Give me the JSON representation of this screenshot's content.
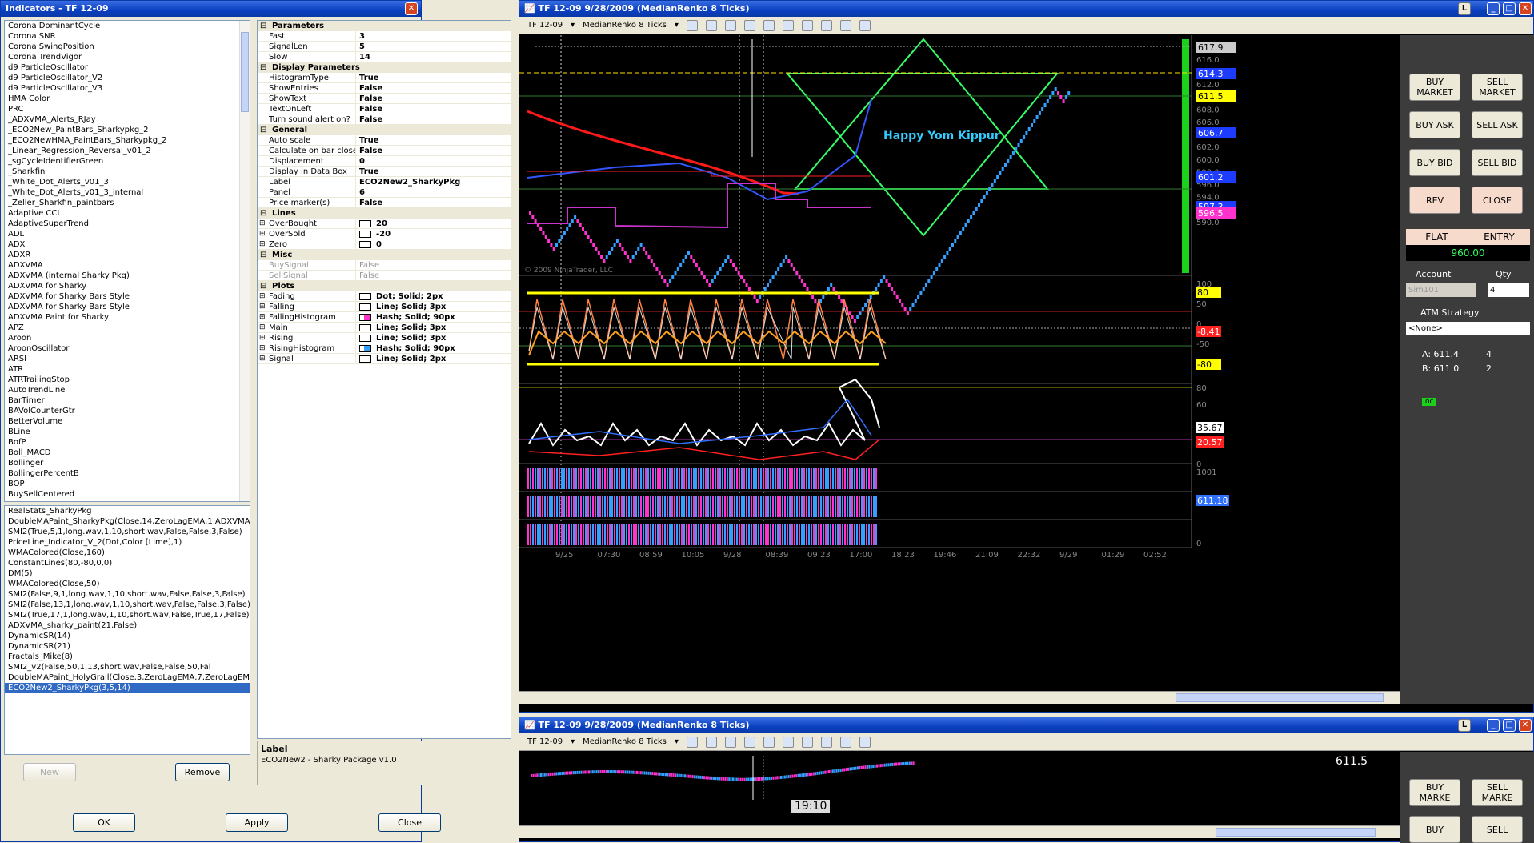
{
  "dialog": {
    "title": "Indicators - TF 12-09",
    "available": [
      "Corona DominantCycle",
      "Corona SNR",
      "Corona SwingPosition",
      "Corona TrendVigor",
      "d9 ParticleOscillator",
      "d9 ParticleOscillator_V2",
      "d9 ParticleOscillator_V3",
      "HMA Color",
      "PRC",
      "_ADXVMA_Alerts_RJay",
      "_ECO2New_PaintBars_Sharkypkg_2",
      "_ECO2NewHMA_PaintBars_Sharkypkg_2",
      "_Linear_Regression_Reversal_v01_2",
      "_sgCycleIdentifierGreen",
      "_Sharkfin",
      "_White_Dot_Alerts_v01_3",
      "_White_Dot_Alerts_v01_3_internal",
      "_Zeller_Sharkfin_paintbars",
      "Adaptive CCI",
      "AdaptiveSuperTrend",
      "ADL",
      "ADX",
      "ADXR",
      "ADXVMA",
      "ADXVMA (internal Sharky Pkg)",
      "ADXVMA for Sharky",
      "ADXVMA for Sharky Bars Style",
      "ADXVMA for Sharky Bars Style",
      "ADXVMA Paint for Sharky",
      "APZ",
      "Aroon",
      "AroonOscillator",
      "ARSI",
      "ATR",
      "ATRTrailingStop",
      "AutoTrendLine",
      "BarTimer",
      "BAVolCounterGtr",
      "BetterVolume",
      "BLine",
      "BofP",
      "Boll_MACD",
      "Bollinger",
      "BollingerPercentB",
      "BOP",
      "BuySellCentered"
    ],
    "applied": [
      "RealStats_SharkyPkg",
      "DoubleMAPaint_SharkyPkg(Close,14,ZeroLagEMA,1,ADXVMA)",
      "SMI2(True,5,1,long.wav,1,10,short.wav,False,False,3,False)",
      "PriceLine_Indicator_V_2(Dot,Color [Lime],1)",
      "WMAColored(Close,160)",
      "ConstantLines(80,-80,0,0)",
      "DM(5)",
      "WMAColored(Close,50)",
      "SMI2(False,9,1,long.wav,1,10,short.wav,False,False,3,False)",
      "SMI2(False,13,1,long.wav,1,10,short.wav,False,False,3,False)",
      "SMI2(True,17,1,long.wav,1,10,short.wav,False,True,17,False)",
      "ADXVMA_sharky_paint(21,False)",
      "DynamicSR(14)",
      "DynamicSR(21)",
      "Fractals_Mike(8)",
      "SMI2_v2(False,50,1,13,short.wav,False,False,50,Fal",
      "DoubleMAPaint_HolyGrail(Close,3,ZeroLagEMA,7,ZeroLagEMA",
      "ECO2New2_SharkyPkg(3,5,14)"
    ],
    "buttons": {
      "new": "New",
      "remove": "Remove",
      "ok": "OK",
      "apply": "Apply",
      "close": "Close"
    },
    "desc": {
      "title": "Label",
      "text": "ECO2New2 - Sharky Package v1.0"
    },
    "props": [
      {
        "cat": "Parameters",
        "rows": [
          [
            "Fast",
            "3"
          ],
          [
            "SignalLen",
            "5"
          ],
          [
            "Slow",
            "14"
          ]
        ]
      },
      {
        "cat": "Display Parameters",
        "rows": [
          [
            "HistogramType",
            "True"
          ],
          [
            "ShowEntries",
            "False"
          ],
          [
            "ShowText",
            "False"
          ],
          [
            "TextOnLeft",
            "False"
          ],
          [
            "Turn sound alert on?",
            "False"
          ]
        ]
      },
      {
        "cat": "General",
        "rows": [
          [
            "Auto scale",
            "True"
          ],
          [
            "Calculate on bar close",
            "False"
          ],
          [
            "Displacement",
            "0"
          ],
          [
            "Display in Data Box",
            "True"
          ],
          [
            "Label",
            "ECO2New2_SharkyPkg"
          ],
          [
            "Panel",
            "6"
          ],
          [
            "Price marker(s)",
            "False"
          ]
        ]
      },
      {
        "cat": "Lines",
        "rows": [
          [
            "OverBought",
            "20",
            1
          ],
          [
            "OverSold",
            "-20",
            1
          ],
          [
            "Zero",
            "0",
            1
          ]
        ]
      },
      {
        "cat": "Misc",
        "rows": [
          [
            "BuySignal",
            "False",
            0,
            1
          ],
          [
            "SellSignal",
            "False",
            0,
            1
          ]
        ]
      },
      {
        "cat": "Plots",
        "rows": [
          [
            "Fading",
            "Dot; Solid; 2px",
            1
          ],
          [
            "Falling",
            "Line; Solid; 3px",
            1
          ],
          [
            "FallingHistogram",
            "Hash; Solid; 90px",
            2
          ],
          [
            "Main",
            "Line; Solid; 3px",
            1
          ],
          [
            "Rising",
            "Line; Solid; 3px",
            1
          ],
          [
            "RisingHistogram",
            "Hash; Solid; 90px",
            3
          ],
          [
            "Signal",
            "Line; Solid; 2px",
            1
          ]
        ]
      }
    ]
  },
  "chart1": {
    "title": "TF 12-09  9/28/2009 (MedianRenko 8 Ticks)",
    "instrument": "TF 12-09",
    "period": "MedianRenko 8 Ticks",
    "annotation": "Happy Yom Kippur",
    "copyright": "© 2009 NinjaTrader, LLC",
    "price_ticks": [
      "616.0",
      "614.0",
      "612.0",
      "610.0",
      "608.0",
      "606.0",
      "604.0",
      "602.0",
      "600.0",
      "598.0",
      "596.0",
      "594.0",
      "592.0",
      "590.0"
    ],
    "price_markers": [
      {
        "v": "617.9",
        "c": "#cccccc"
      },
      {
        "v": "614.3",
        "c": "#1e3cff"
      },
      {
        "v": "611.5",
        "c": "#ffff00"
      },
      {
        "v": "606.7",
        "c": "#1e3cff"
      },
      {
        "v": "601.2",
        "c": "#1e3cff"
      },
      {
        "v": "597.3",
        "c": "#1e3cff"
      },
      {
        "v": "596.5",
        "c": "#ff33cc"
      }
    ],
    "osc_ticks": [
      "100",
      "50",
      "0",
      "-50",
      "-100"
    ],
    "osc_markers": [
      {
        "v": "80",
        "c": "#ffff00"
      },
      {
        "v": "-8.41",
        "c": "#ff2020"
      },
      {
        "v": "-80",
        "c": "#ffff00"
      }
    ],
    "dm_ticks": [
      "80",
      "60",
      "20",
      "0"
    ],
    "dm_markers": [
      {
        "v": "35.67",
        "c": "#ffffff"
      },
      {
        "v": "20.57",
        "c": "#ff2020"
      }
    ],
    "hist_ticks": [
      "1001",
      "0"
    ],
    "hist_marker": "611.18",
    "time_ticks": [
      "9/25",
      "07:30",
      "08:59",
      "10:05",
      "9/28",
      "08:39",
      "09:23",
      "17:00",
      "18:23",
      "19:46",
      "21:09",
      "22:32",
      "9/29",
      "01:29",
      "02:52"
    ]
  },
  "side": {
    "buy_market": "BUY MARKET",
    "sell_market": "SELL MARKET",
    "buy_ask": "BUY ASK",
    "sell_ask": "SELL ASK",
    "buy_bid": "BUY BID",
    "sell_bid": "SELL BID",
    "rev": "REV",
    "close": "CLOSE",
    "flat": "FLAT",
    "entry": "ENTRY",
    "pnl": "960.00",
    "account_label": "Account",
    "qty_label": "Qty",
    "account": "Sim101",
    "qty": "4",
    "atm_label": "ATM Strategy",
    "atm": "<None>",
    "ask": "A: 611.4",
    "ask_qty": "4",
    "bid": "B: 611.0",
    "bid_qty": "2",
    "oc": "oc"
  },
  "chart2": {
    "title": "TF 12-09  9/28/2009 (MedianRenko 8 Ticks)",
    "instrument": "TF 12-09",
    "period": "MedianRenko 8 Ticks",
    "price": "611.5",
    "time": "19:10",
    "buy_market": "BUY MARKE",
    "sell_market": "SELL MARKE",
    "buy_ask": "BUY",
    "sell_ask": "SELL"
  },
  "colors": {
    "title_blue": "#0a3fbf",
    "up_bar": "#33a0ff",
    "down_bar": "#ff33cc",
    "star": "#33ff66",
    "wma": "#ff1a1a",
    "annotation": "#33ccff"
  }
}
